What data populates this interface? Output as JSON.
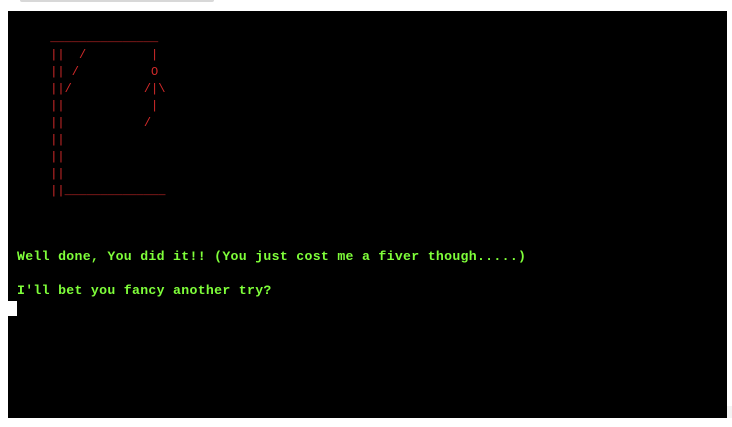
{
  "terminal": {
    "gallows_art": " _______________\n ||  /         |\n || /          O\n ||/          /|\\\n ||            |\n ||           /\n ||\n ||\n ||\n ||______________",
    "message_1": "Well done, You did it!! (You just cost me a fiver though.....)",
    "message_2": "I'll bet you fancy another try?"
  },
  "colors": {
    "background": "#000000",
    "gallows": "#d42a2a",
    "text": "#7fff3a",
    "cursor": "#ffffff"
  }
}
